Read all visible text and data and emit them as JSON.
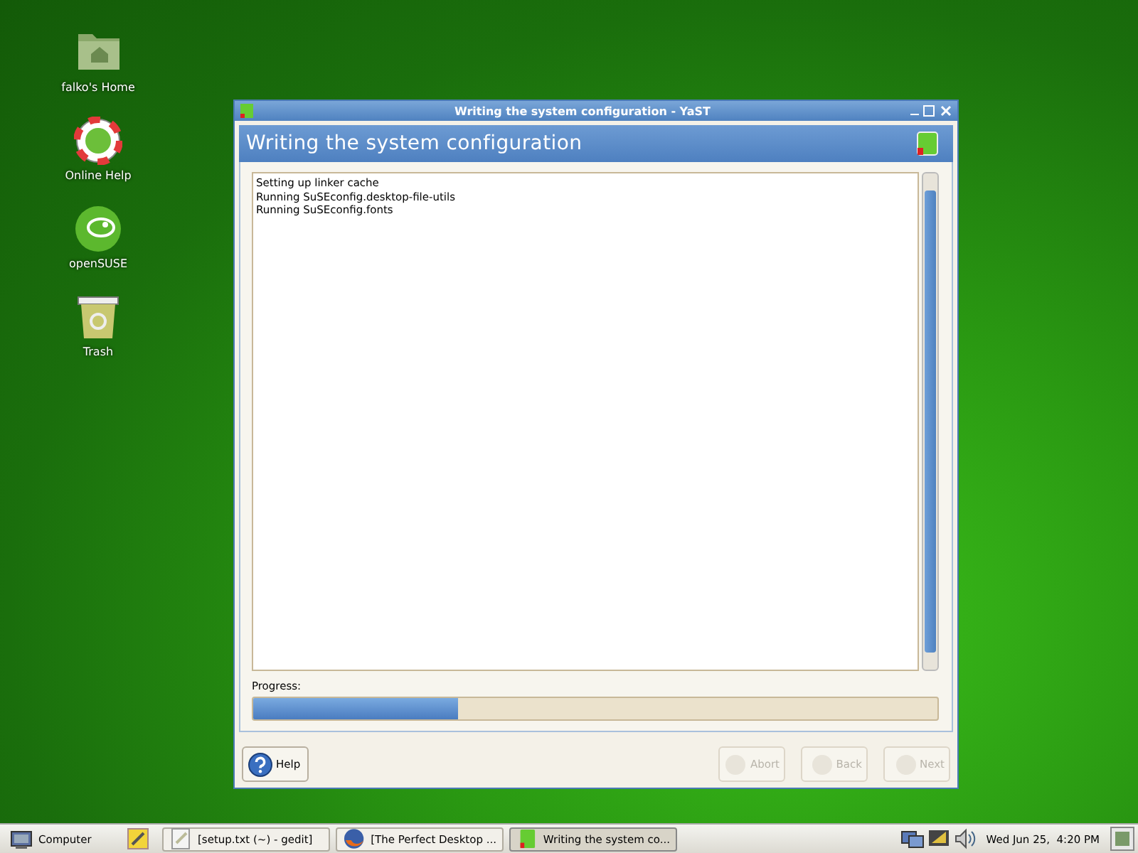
{
  "desktop_icons": [
    {
      "label": "falko's Home",
      "kind": "folder"
    },
    {
      "label": "Online Help",
      "kind": "help"
    },
    {
      "label": "openSUSE",
      "kind": "logo"
    },
    {
      "label": "Trash",
      "kind": "trash"
    }
  ],
  "window": {
    "title": "Writing the system configuration - YaST",
    "heading": "Writing the system configuration",
    "log": [
      "Setting up linker cache",
      "Running SuSEconfig.desktop-file-utils",
      "Running SuSEconfig.fonts"
    ],
    "progress": {
      "label": "Progress:",
      "level": 0.3
    },
    "buttons": [
      {
        "label": "Help",
        "kind": "help",
        "disabled": false
      },
      {
        "label": "Abort",
        "kind": "action",
        "disabled": true
      },
      {
        "label": "Back",
        "kind": "action",
        "disabled": true
      },
      {
        "label": "Next",
        "kind": "action",
        "disabled": true
      }
    ]
  },
  "taskbar": {
    "menu_label": "Computer",
    "tasks": [
      {
        "label": "[setup.txt (~) - gedit]",
        "kind": "editor",
        "selected": false
      },
      {
        "label": "[The Perfect Desktop ...",
        "kind": "browser",
        "selected": false
      },
      {
        "label": "Writing the system co...",
        "kind": "yast",
        "selected": true
      }
    ],
    "clock": "Wed Jun 25,  4:20 PM"
  }
}
